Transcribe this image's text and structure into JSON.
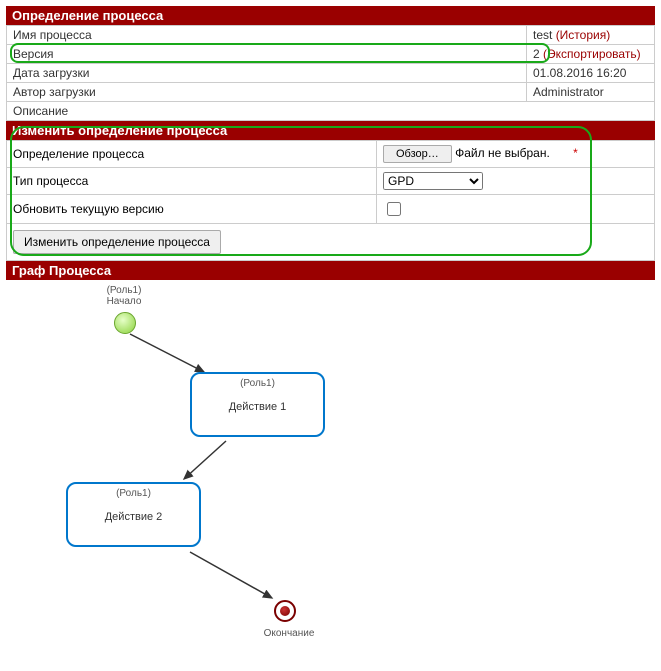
{
  "section1": {
    "title": "Определение процесса",
    "rows": {
      "name_label": "Имя процесса",
      "name_value": "test",
      "history_link": "(История)",
      "version_label": "Версия",
      "version_value": "2",
      "export_link": "(Экспортировать)",
      "uploaded_label": "Дата загрузки",
      "uploaded_value": "01.08.2016 16:20",
      "author_label": "Автор загрузки",
      "author_value": "Administrator",
      "desc_label": "Описание"
    }
  },
  "section2": {
    "title": "Изменить определение процесса",
    "def_label": "Определение процесса",
    "browse_btn": "Обзор…",
    "nofile": "Файл не выбран.",
    "type_label": "Тип процесса",
    "type_value": "GPD",
    "type_options": [
      "GPD"
    ],
    "update_label": "Обновить текущую версию",
    "submit_btn": "Изменить определение процесса"
  },
  "section3": {
    "title": "Граф Процесса",
    "start_role": "(Роль1)",
    "start_label": "Начало",
    "task1_role": "(Роль1)",
    "task1_label": "Действие 1",
    "task2_role": "(Роль1)",
    "task2_label": "Действие 2",
    "end_label": "Окончание"
  }
}
